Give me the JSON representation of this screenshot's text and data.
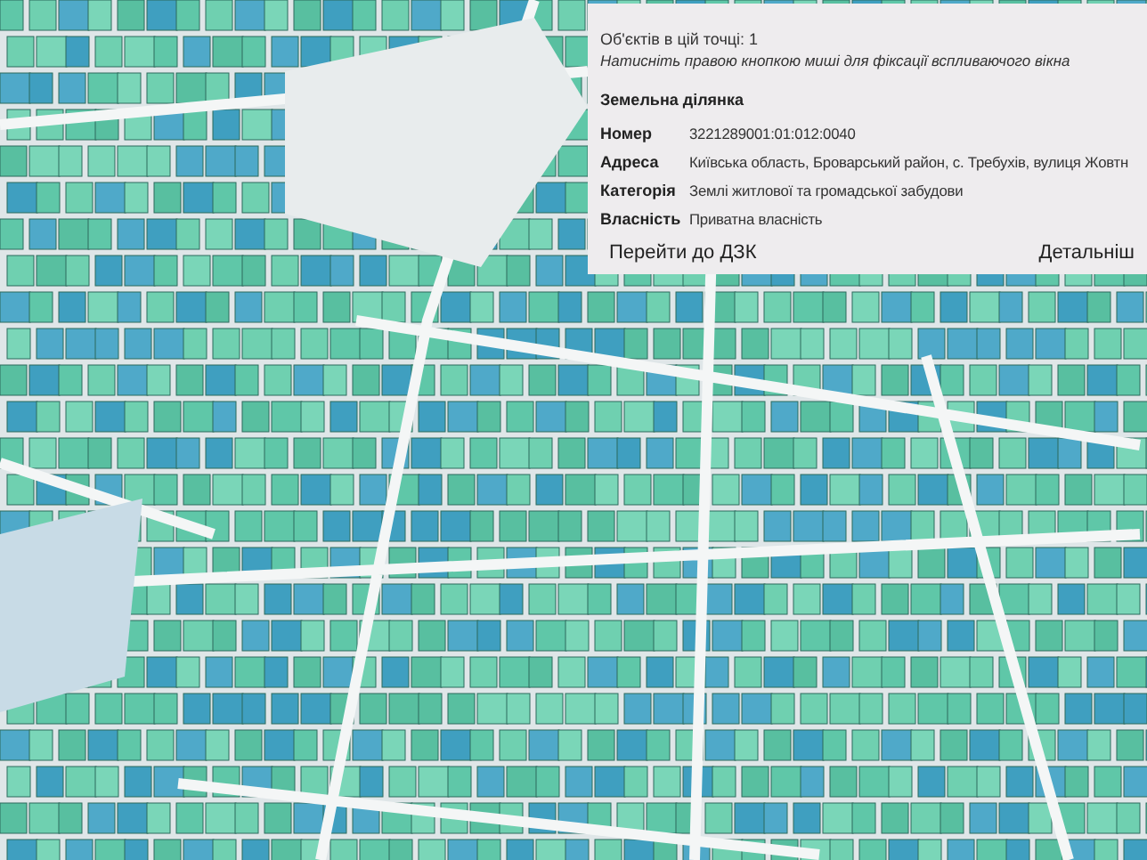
{
  "popup": {
    "count_line": "Об'єктів в цій точці: 1",
    "hint": "Натисніть правою кнопкою миші для фіксації вспливаючого вікна",
    "section_title": "Земельна ділянка",
    "fields": [
      {
        "label": "Номер",
        "value": "3221289001:01:012:0040"
      },
      {
        "label": "Адреса",
        "value": "Київська область, Броварський район, с. Требухів, вулиця Жовтн"
      },
      {
        "label": "Категорія",
        "value": "Землі житлової та громадської забудови"
      },
      {
        "label": "Власність",
        "value": "Приватна власність"
      }
    ],
    "links": [
      "Перейти до ДЗК",
      "Детальніш"
    ]
  }
}
